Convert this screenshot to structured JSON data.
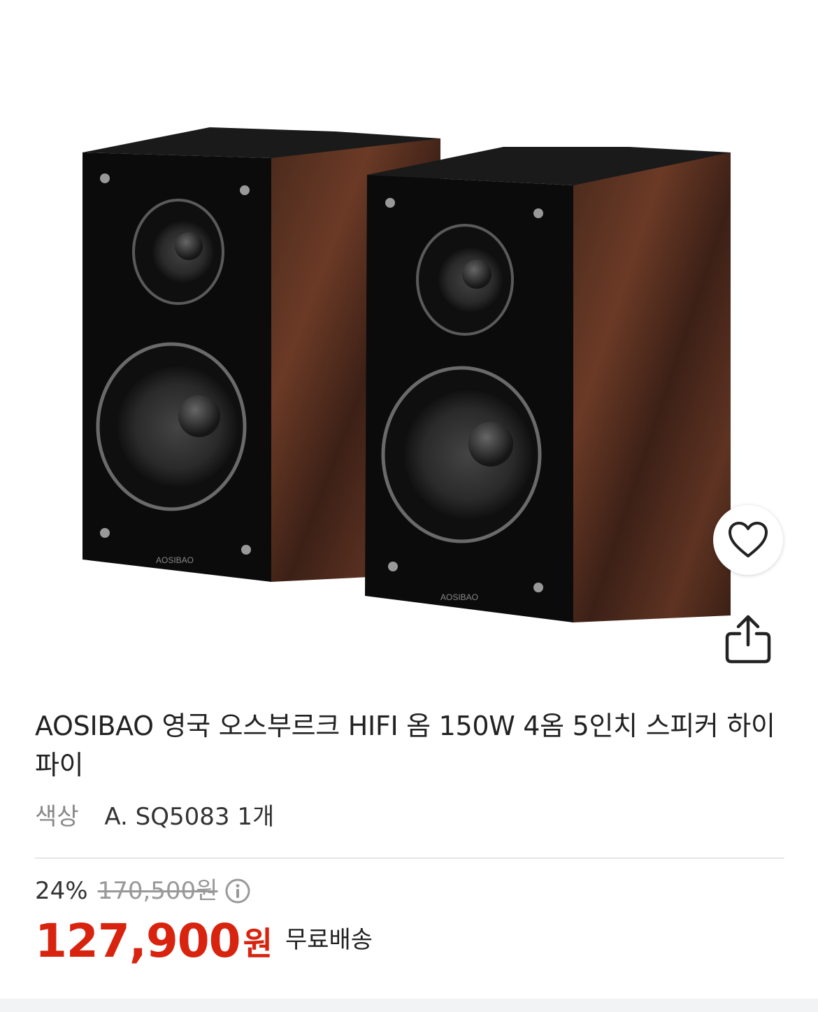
{
  "product": {
    "title": "AOSIBAO 영국 오스부르크 HIFI 옴 150W 4옴 5인치 스피커 하이파이",
    "image_alt": "AOSIBAO bookshelf speakers pair",
    "brand_mark": "AOSIBAO"
  },
  "option": {
    "label": "색상",
    "value": "A. SQ5083 1개"
  },
  "pricing": {
    "discount": "24%",
    "original_price": "170,500원",
    "price": "127,900",
    "currency": "원",
    "shipping": "무료배송"
  },
  "colors": {
    "price": "#d8230f",
    "divider": "#e6e6e6"
  },
  "icons": {
    "wishlist": "heart-icon",
    "share": "share-icon",
    "info": "info-icon"
  }
}
